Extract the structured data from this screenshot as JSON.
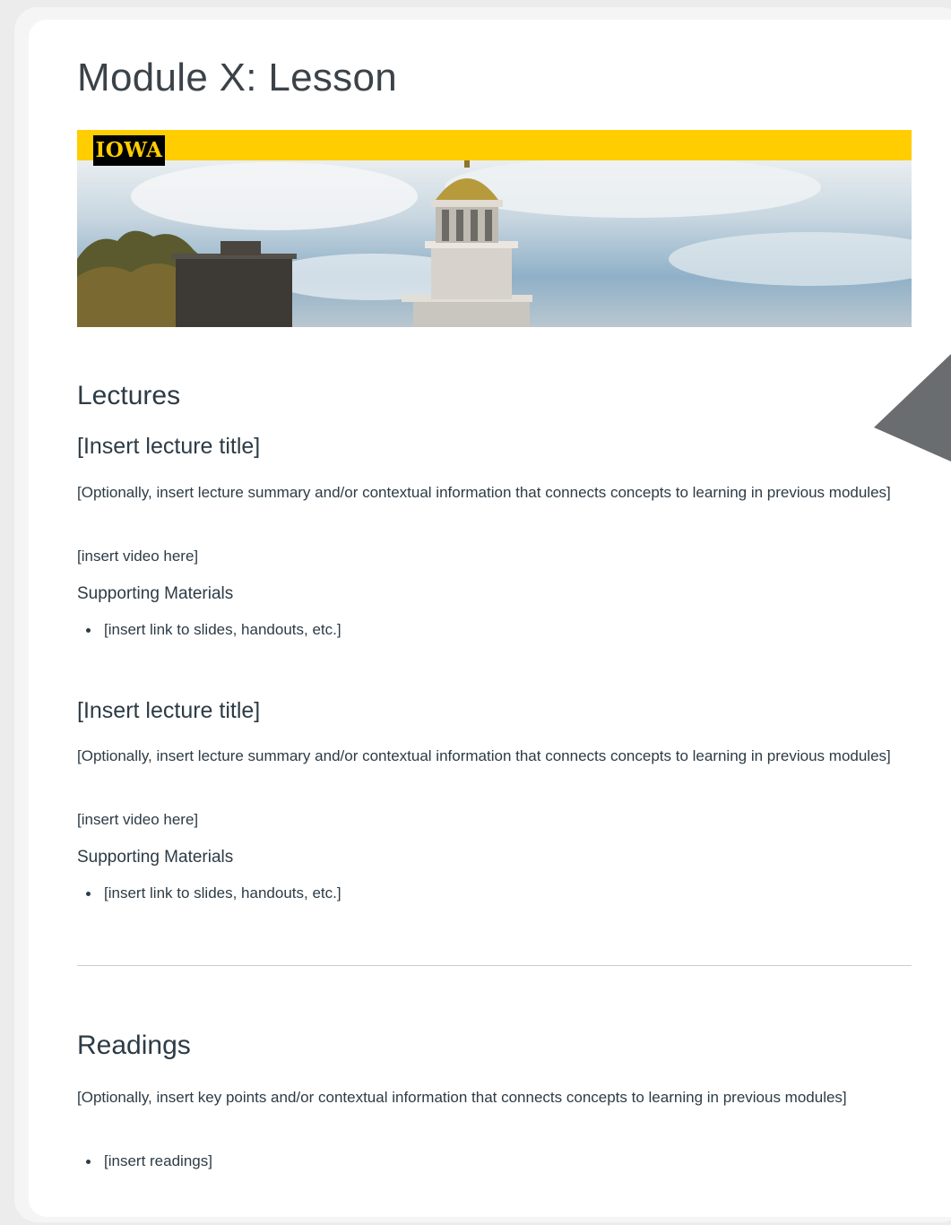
{
  "page": {
    "title": "Module X: Lesson"
  },
  "banner": {
    "logo_text": "IOWA",
    "accent_color": "#ffcd00"
  },
  "lectures": {
    "heading": "Lectures",
    "items": [
      {
        "title": "[Insert lecture title]",
        "summary": "[Optionally, insert lecture summary and/or contextual information that connects concepts to learning in previous modules]",
        "video": "[insert video here]",
        "materials_heading": "Supporting Materials",
        "materials": [
          "[insert link to slides, handouts, etc.]"
        ]
      },
      {
        "title": "[Insert lecture title]",
        "summary": "[Optionally, insert lecture summary and/or contextual information that connects concepts to learning in previous modules]",
        "video": "[insert video here]",
        "materials_heading": "Supporting Materials",
        "materials": [
          "[insert link to slides, handouts, etc.]"
        ]
      }
    ]
  },
  "readings": {
    "heading": "Readings",
    "summary": "[Optionally, insert key points and/or contextual information that connects concepts to learning in previous modules]",
    "items": [
      "[insert readings]"
    ]
  }
}
